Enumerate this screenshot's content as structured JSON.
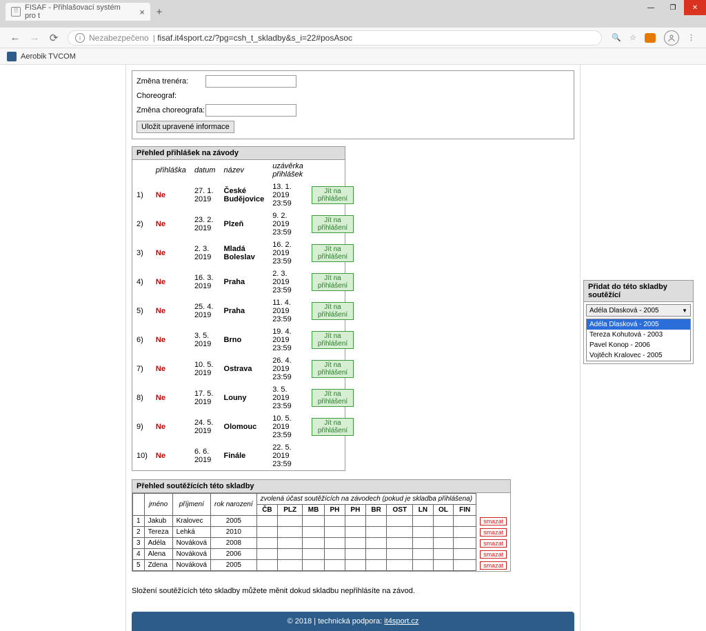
{
  "window": {
    "tab_title": "FISAF - Přihlašovací systém pro t",
    "bookmark": "Aerobik TVCOM"
  },
  "address": {
    "insecure_label": "Nezabezpečeno",
    "url": "fisaf.it4sport.cz/?pg=csh_t_skladby&s_i=22#posAsoc"
  },
  "form": {
    "trainer_change_label": "Změna trenéra:",
    "choreographer_label": "Choreograf:",
    "choreographer_change_label": "Změna choreografa:",
    "save_button": "Uložit upravené informace"
  },
  "overview": {
    "title": "Přehled přihlášek na závody",
    "headers": {
      "entry": "přihláška",
      "date": "datum",
      "name": "název",
      "deadline": "uzávěrka přihlášek"
    },
    "go_label": "Jít na přihlášení",
    "rows": [
      {
        "n": "1)",
        "entry": "Ne",
        "date": "27. 1. 2019",
        "name": "České Budějovice",
        "deadline": "13. 1. 2019 23:59",
        "btn": true
      },
      {
        "n": "2)",
        "entry": "Ne",
        "date": "23. 2. 2019",
        "name": "Plzeň",
        "deadline": "9. 2. 2019 23:59",
        "btn": true
      },
      {
        "n": "3)",
        "entry": "Ne",
        "date": "2. 3. 2019",
        "name": "Mladá Boleslav",
        "deadline": "16. 2. 2019 23:59",
        "btn": true
      },
      {
        "n": "4)",
        "entry": "Ne",
        "date": "16. 3. 2019",
        "name": "Praha",
        "deadline": "2. 3. 2019 23:59",
        "btn": true
      },
      {
        "n": "5)",
        "entry": "Ne",
        "date": "25. 4. 2019",
        "name": "Praha",
        "deadline": "11. 4. 2019 23:59",
        "btn": true
      },
      {
        "n": "6)",
        "entry": "Ne",
        "date": "3. 5. 2019",
        "name": "Brno",
        "deadline": "19. 4. 2019 23:59",
        "btn": true
      },
      {
        "n": "7)",
        "entry": "Ne",
        "date": "10. 5. 2019",
        "name": "Ostrava",
        "deadline": "26. 4. 2019 23:59",
        "btn": true
      },
      {
        "n": "8)",
        "entry": "Ne",
        "date": "17. 5. 2019",
        "name": "Louny",
        "deadline": "3. 5. 2019 23:59",
        "btn": true
      },
      {
        "n": "9)",
        "entry": "Ne",
        "date": "24. 5. 2019",
        "name": "Olomouc",
        "deadline": "10. 5. 2019 23:59",
        "btn": true
      },
      {
        "n": "10)",
        "entry": "Ne",
        "date": "6. 6. 2019",
        "name": "Finále",
        "deadline": "22. 5. 2019 23:59",
        "btn": false
      }
    ]
  },
  "competitors": {
    "title": "Přehled soutěžících této skladby",
    "headers": {
      "first": "jméno",
      "last": "příjmení",
      "year": "rok narození",
      "participation": "zvolená účast soutěžících na závodech (pokud je skladba přihlášena)"
    },
    "cols": [
      "ČB",
      "PLZ",
      "MB",
      "PH",
      "PH",
      "BR",
      "OST",
      "LN",
      "OL",
      "FIN"
    ],
    "delete_label": "smazat",
    "rows": [
      {
        "n": "1",
        "first": "Jakub",
        "last": "Kralovec",
        "year": "2005"
      },
      {
        "n": "2",
        "first": "Tereza",
        "last": "Lehká",
        "year": "2010"
      },
      {
        "n": "3",
        "first": "Adéla",
        "last": "Nováková",
        "year": "2008"
      },
      {
        "n": "4",
        "first": "Alena",
        "last": "Nováková",
        "year": "2006"
      },
      {
        "n": "5",
        "first": "Zdena",
        "last": "Nováková",
        "year": "2005"
      }
    ]
  },
  "note": "Složení soutěžících této skladby můžete měnit dokud skladbu nepřihlásíte na závod.",
  "add_panel": {
    "title": "Přidat do této skladby soutěžící",
    "selected": "Adéla Dlasková - 2005",
    "options": [
      "Adéla Dlasková - 2005",
      "Tereza Kohutová - 2003",
      "Pavel Konop - 2006",
      "Vojtěch Kralovec - 2005"
    ]
  },
  "footer": {
    "copyright": "© 2018 |",
    "support": "technická podpora:",
    "link": "it4sport.cz"
  }
}
